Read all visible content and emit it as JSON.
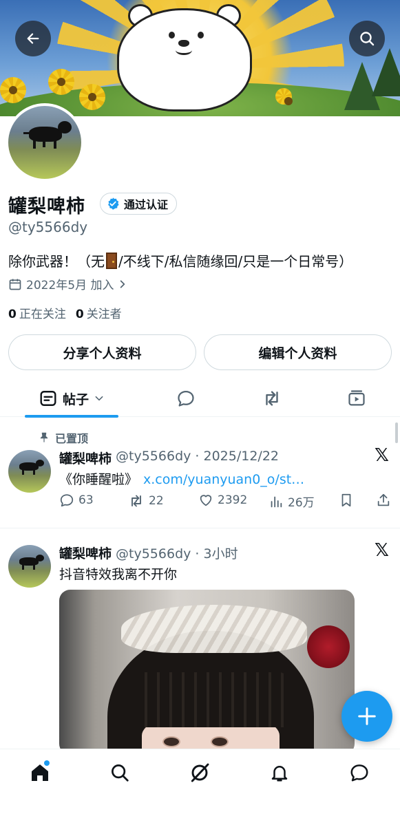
{
  "profile": {
    "display_name": "罐梨啤柿",
    "verified_label": "通过认证",
    "handle": "@ty5566dy",
    "bio_before": "除你武器！（无",
    "bio_after": "/不线下/私信随缘回/只是一个日常号）",
    "joined": "2022年5月 加入",
    "following_count": "0",
    "following_label": "正在关注",
    "followers_count": "0",
    "followers_label": "关注者"
  },
  "buttons": {
    "share": "分享个人资料",
    "edit": "编辑个人资料"
  },
  "tabs": {
    "posts": "帖子"
  },
  "posts": [
    {
      "pinned_label": "已置顶",
      "name": "罐梨啤柿",
      "handle_time": "@ty5566dy · 2025/12/22",
      "text": "《你睡醒啦》",
      "link": "x.com/yuanyuan0_o/st…",
      "replies": "63",
      "reposts": "22",
      "likes": "2392",
      "views": "26万"
    },
    {
      "name": "罐梨啤柿",
      "handle_time": "@ty5566dy · 3小时",
      "text": "抖音特效我离不开你"
    }
  ],
  "colors": {
    "accent": "#1d9bf0",
    "text": "#0f1419",
    "muted": "#536471",
    "border": "#cfd9de"
  },
  "icons": [
    "back-arrow-icon",
    "search-icon",
    "verified-badge-icon",
    "calendar-icon",
    "chevron-right-icon",
    "posts-tab-icon",
    "chevron-down-icon",
    "reply-icon",
    "repost-icon",
    "media-icon",
    "pin-icon",
    "x-logo-icon",
    "like-icon",
    "views-icon",
    "bookmark-icon",
    "share-icon",
    "plus-icon",
    "home-icon",
    "grok-icon",
    "notifications-icon",
    "messages-icon"
  ]
}
